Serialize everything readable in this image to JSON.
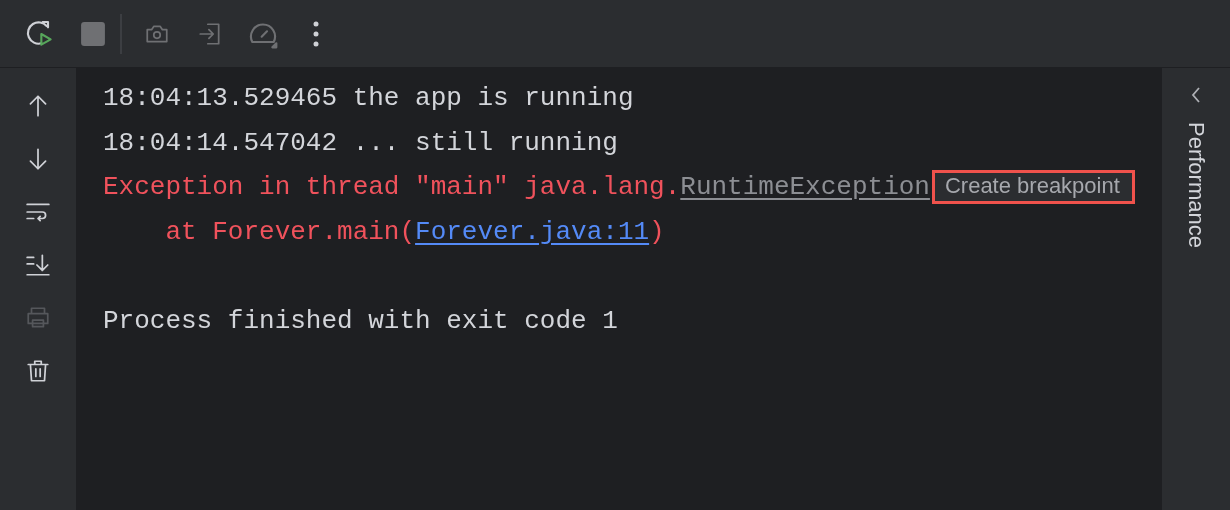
{
  "toolbar": [
    {
      "kind": "rerun",
      "disabled": false
    },
    {
      "kind": "stop",
      "disabled": true
    },
    {
      "kind": "separator"
    },
    {
      "kind": "camera",
      "disabled": true
    },
    {
      "kind": "import",
      "disabled": true
    },
    {
      "kind": "gauge",
      "disabled": true
    },
    {
      "kind": "more",
      "disabled": false
    }
  ],
  "gutter": [
    {
      "kind": "up",
      "disabled": false
    },
    {
      "kind": "down",
      "disabled": false
    },
    {
      "kind": "wrap",
      "disabled": false
    },
    {
      "kind": "scroll-end",
      "disabled": false
    },
    {
      "kind": "print",
      "disabled": true
    },
    {
      "kind": "trash",
      "disabled": false
    }
  ],
  "console": [
    {
      "segments": [
        {
          "kind": "text",
          "text": "18:04:13.529465 the app is running"
        }
      ]
    },
    {
      "segments": [
        {
          "kind": "text",
          "text": "18:04:14.547042 ... still running"
        }
      ]
    },
    {
      "segments": [
        {
          "kind": "error",
          "text": "Exception in thread \"main\" java.lang."
        },
        {
          "kind": "class-link",
          "text": "RuntimeException"
        },
        {
          "kind": "hint",
          "text": "Create breakpoint"
        }
      ]
    },
    {
      "segments": [
        {
          "kind": "error",
          "text": "    at Forever.main("
        },
        {
          "kind": "link",
          "text": "Forever.java:11"
        },
        {
          "kind": "error",
          "text": ")"
        }
      ]
    }
  ],
  "exit_message": "Process finished with exit code 1",
  "side_panel": {
    "title": "Performance",
    "collapsed": true
  }
}
